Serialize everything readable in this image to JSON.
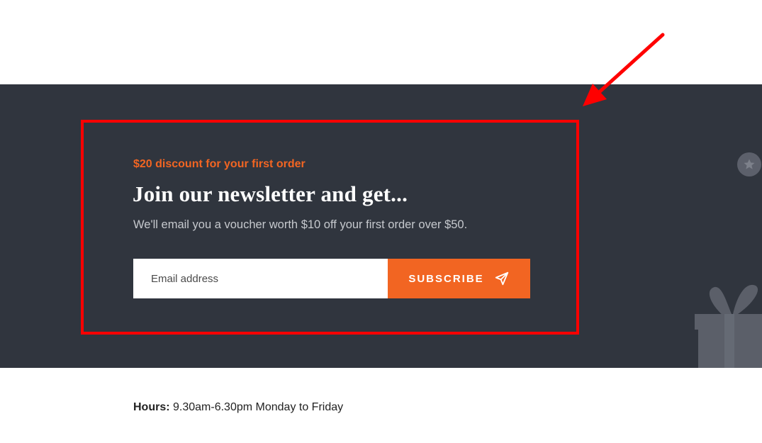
{
  "newsletter": {
    "eyebrow": "$20 discount for your first order",
    "headline": "Join our newsletter and get...",
    "subtext": "We'll email you a voucher worth $10 off your first order over $50.",
    "email_placeholder": "Email address",
    "subscribe_label": "SUBSCRIBE",
    "subscribe_icon": "send-icon"
  },
  "decor": {
    "badge_icon": "star-icon",
    "gift_icon": "gift-icon",
    "annotation_arrow": "red-arrow",
    "highlight_box": "red-highlight-box"
  },
  "footer": {
    "hours_label": "Hours:",
    "hours_value": " 9.30am-6.30pm Monday to Friday"
  },
  "colors": {
    "band_bg": "#30353e",
    "accent": "#f26522",
    "annotation": "#ff0000"
  }
}
